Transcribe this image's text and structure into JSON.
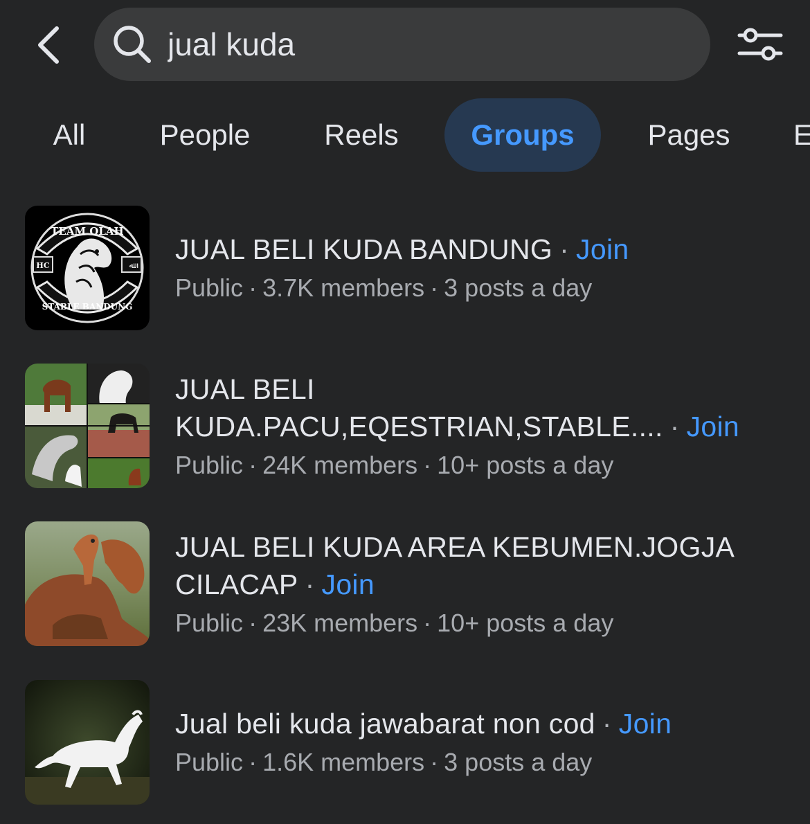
{
  "search": {
    "query": "jual kuda"
  },
  "tabs": [
    {
      "label": "All",
      "active": false
    },
    {
      "label": "People",
      "active": false
    },
    {
      "label": "Reels",
      "active": false
    },
    {
      "label": "Groups",
      "active": true
    },
    {
      "label": "Pages",
      "active": false
    },
    {
      "label": "E",
      "active": false
    }
  ],
  "results": [
    {
      "title": "JUAL BELI KUDA BANDUNG",
      "join_label": "Join",
      "privacy": "Public",
      "members": "3.7K members",
      "activity": "3 posts a day",
      "thumb_text": {
        "top": "TEAM OLAH",
        "bottom": "STABLE BANDUNG",
        "left": "HC",
        "right": "ﷲ"
      }
    },
    {
      "title_line1": "JUAL BELI",
      "title_line2": "KUDA.PACU,EQESTRIAN,STABLE....",
      "join_label": "Join",
      "privacy": "Public",
      "members": "24K members",
      "activity": "10+ posts a day"
    },
    {
      "title_line1": "JUAL BELI KUDA AREA KEBUMEN.JOGJA",
      "title_line2": "CILACAP",
      "join_label": "Join",
      "privacy": "Public",
      "members": "23K members",
      "activity": "10+ posts a day"
    },
    {
      "title": "Jual beli kuda jawabarat non cod",
      "join_label": "Join",
      "privacy": "Public",
      "members": "1.6K members",
      "activity": "3 posts a day"
    }
  ],
  "colors": {
    "background": "#242526",
    "accent": "#4599ff",
    "active_tab_bg": "#263951",
    "search_bg": "#3a3b3c"
  }
}
